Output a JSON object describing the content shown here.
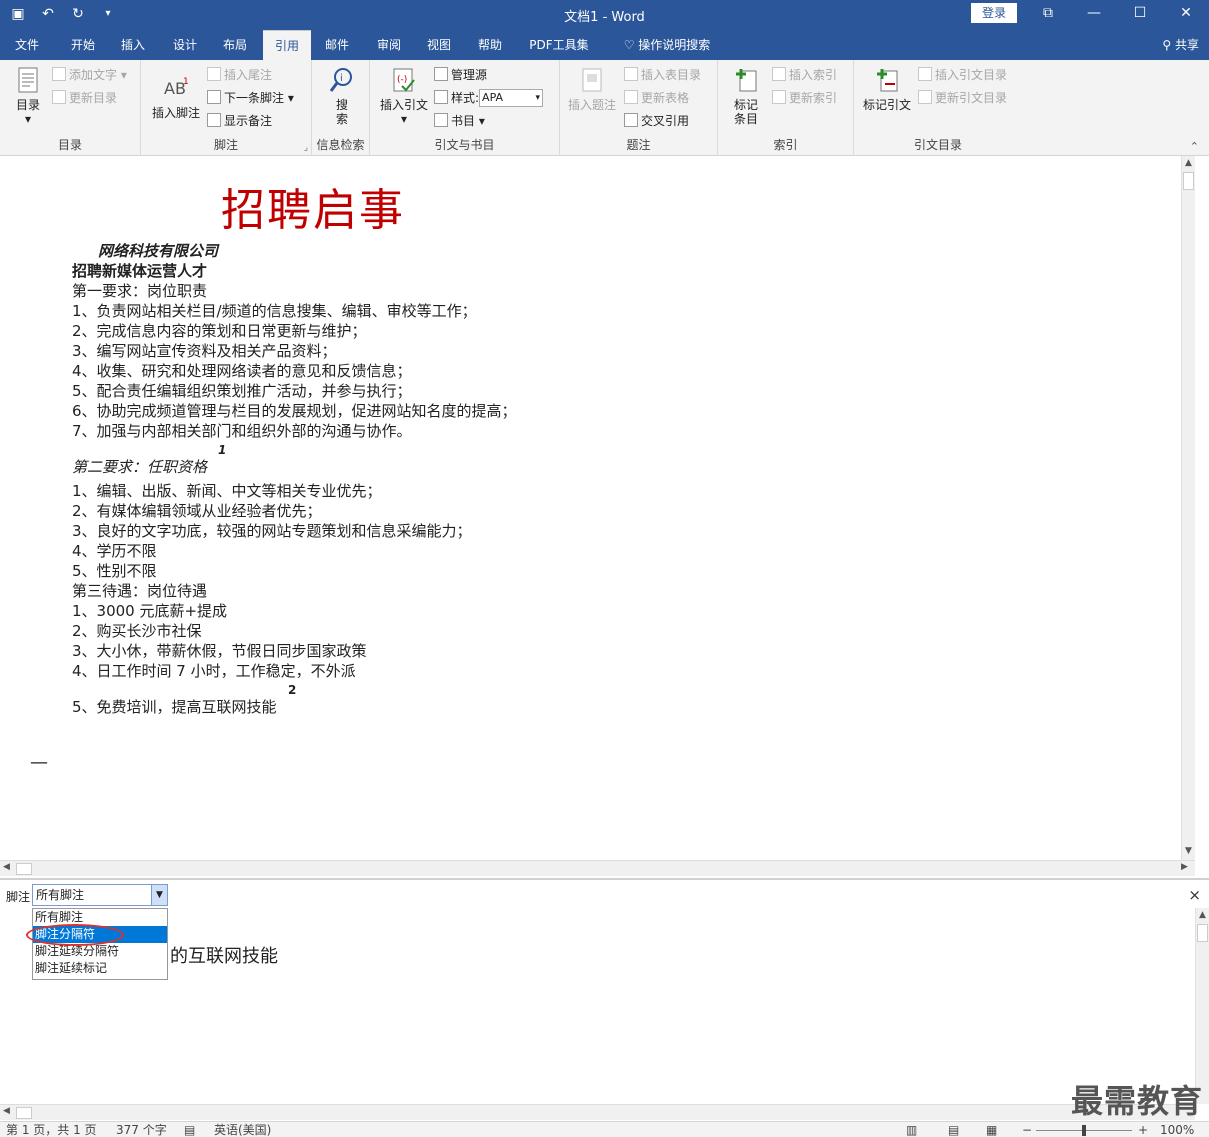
{
  "window": {
    "title": "文档1 - Word",
    "login": "登录",
    "minimize": "—",
    "maximize": "☐",
    "close": "✕",
    "restore": "⧉"
  },
  "tabs": [
    "文件",
    "开始",
    "插入",
    "设计",
    "布局",
    "引用",
    "邮件",
    "审阅",
    "视图",
    "帮助",
    "PDF工具集"
  ],
  "tell_me": "操作说明搜索",
  "share": "共享",
  "ribbon": {
    "toc": {
      "label": "目录",
      "button": "目录",
      "add_text": "添加文字",
      "update_toc": "更新目录"
    },
    "footnotes": {
      "label": "脚注",
      "insert_footnote": "插入脚注",
      "insert_endnote": "插入尾注",
      "next_footnote": "下一条脚注",
      "show_notes": "显示备注"
    },
    "research": {
      "label": "信息检索",
      "search": "搜索"
    },
    "citations": {
      "label": "引文与书目",
      "insert_citation": "插入引文",
      "manage_sources": "管理源",
      "style_label": "样式:",
      "style_value": "APA",
      "bibliography": "书目"
    },
    "captions": {
      "label": "题注",
      "insert_caption": "插入题注",
      "insert_tof": "插入表目录",
      "update_table": "更新表格",
      "cross_ref": "交叉引用"
    },
    "index": {
      "label": "索引",
      "mark_entry": "标记条目",
      "insert_index": "插入索引",
      "update_index": "更新索引"
    },
    "toa": {
      "label": "引文目录",
      "mark_citation": "标记引文",
      "insert_toa": "插入引文目录",
      "update_toa": "更新引文目录"
    }
  },
  "document": {
    "title": "招聘启事",
    "company": "网络科技有限公司",
    "position": "招聘新媒体运营人才",
    "req1_title": "第一要求：岗位职责",
    "req1_items": [
      "1、负责网站相关栏目/频道的信息搜集、编辑、审校等工作；",
      "2、完成信息内容的策划和日常更新与维护；",
      "3、编写网站宣传资料及相关产品资料；",
      "4、收集、研究和处理网络读者的意见和反馈信息；",
      "5、配合责任编辑组织策划推广活动，并参与执行；",
      "6、协助完成频道管理与栏目的发展规划，促进网站知名度的提高；",
      "7、加强与内部相关部门和组织外部的沟通与协作。"
    ],
    "footnote_mark_1": "1",
    "req2_title": "第二要求：任职资格",
    "req2_items": [
      "1、编辑、出版、新闻、中文等相关专业优先；",
      "2、有媒体编辑领域从业经验者优先；",
      "3、良好的文字功底，较强的网站专题策划和信息采编能力；",
      "4、学历不限",
      "5、性别不限"
    ],
    "req3_title": "第三待遇：岗位待遇",
    "req3_items": [
      "1、3000 元底薪+提成",
      "2、购买长沙市社保",
      "3、大小休，带薪休假，节假日同步国家政策",
      "4、日工作时间 7 小时，工作稳定，不外派"
    ],
    "req3_last": "5、免费培训，提高互联网技能",
    "footnote_mark_2": "2",
    "separator": "—"
  },
  "footnote_pane": {
    "label": "脚注",
    "selected": "所有脚注",
    "options": [
      "所有脚注",
      "脚注分隔符",
      "脚注延续分隔符",
      "脚注延续标记"
    ],
    "close": "×",
    "visible_text": "的互联网技能"
  },
  "status": {
    "page": "第 1 页，共 1 页",
    "words": "377 个字",
    "language": "英语(美国)",
    "zoom": "100%"
  },
  "watermark": "最需教育",
  "colors": {
    "brand": "#2b579a",
    "title_red": "#c00000",
    "highlight": "#0078d7",
    "ring": "#e0302c"
  }
}
